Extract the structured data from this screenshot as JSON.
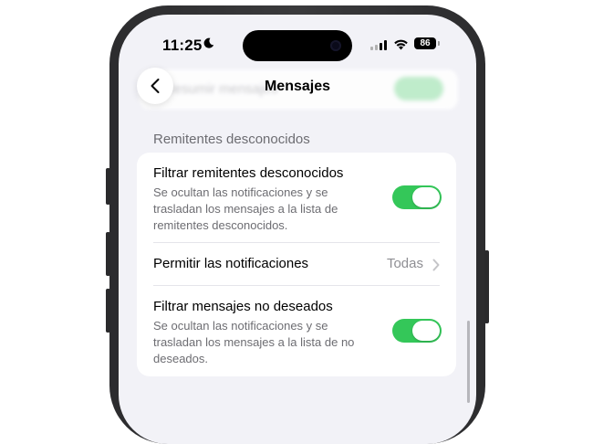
{
  "status_bar": {
    "time": "11:25",
    "battery": "86"
  },
  "nav": {
    "title": "Mensajes",
    "blurred_row_text": "Resumir mensajes"
  },
  "section": {
    "header": "Remitentes desconocidos",
    "rows": [
      {
        "title": "Filtrar remitentes desconocidos",
        "description": "Se ocultan las notificaciones y se trasladan los mensajes a la lista de remitentes desconocidos.",
        "toggle_on": true
      },
      {
        "title": "Permitir las notificaciones",
        "value": "Todas"
      },
      {
        "title": "Filtrar mensajes no deseados",
        "description": "Se ocultan las notificaciones y se trasladan los mensajes a la lista de no deseados.",
        "toggle_on": true
      }
    ]
  },
  "colors": {
    "accent_green": "#34c759",
    "background": "#f2f2f7"
  },
  "icons": [
    "moon-icon",
    "cellular-signal-icon",
    "wifi-icon",
    "battery-icon",
    "back-chevron-icon",
    "chevron-right-icon"
  ]
}
